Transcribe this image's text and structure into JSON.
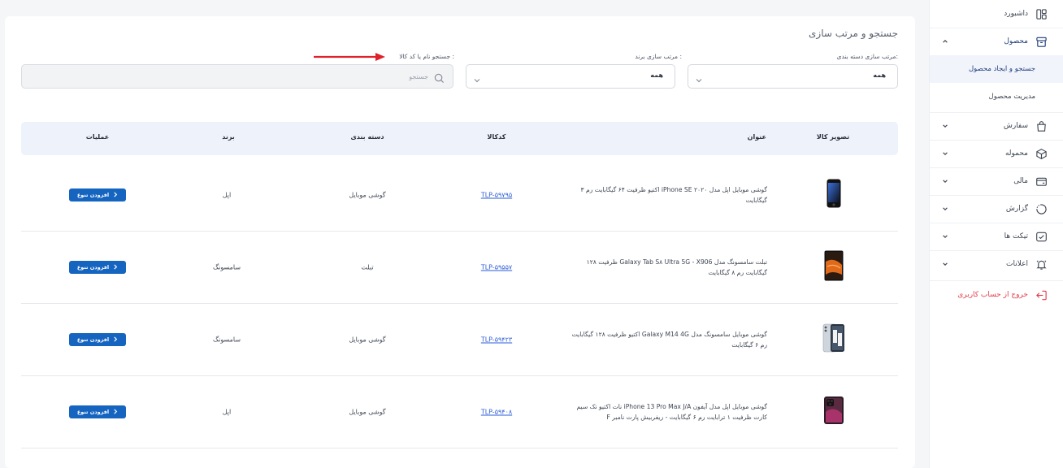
{
  "sidebar": {
    "items": [
      {
        "label": "داشبورد",
        "icon": "dashboard-icon"
      },
      {
        "label": "محصول",
        "icon": "box-icon"
      },
      {
        "label": "سفارش",
        "icon": "shopping-bag-icon"
      },
      {
        "label": "محموله",
        "icon": "package-icon"
      },
      {
        "label": "مالی",
        "icon": "wallet-icon"
      },
      {
        "label": "گزارش",
        "icon": "report-icon"
      },
      {
        "label": "تیکت ها",
        "icon": "ticket-icon"
      },
      {
        "label": "اعلانات",
        "icon": "bell-icon"
      }
    ],
    "sub_items": [
      {
        "label": "جستجو و ایجاد محصول"
      },
      {
        "label": "مدیریت محصول"
      }
    ],
    "logout_label": "خروج از حساب کاربری",
    "accent": "#1d3a7a",
    "logout_color": "#e23b4a"
  },
  "main": {
    "title": "جستجو و مرتب سازی",
    "filters": {
      "category_label": "مرتب سازی دسته بندی:",
      "category_value": "همه",
      "brand_label": "مرتب سازی برند :",
      "brand_value": "همه",
      "search_label": "جستجو نام یا کد کالا :",
      "search_placeholder": "جستجو"
    },
    "table": {
      "headers": {
        "image": "تصویر کالا",
        "title": "عنوان",
        "code": "کدکالا",
        "category": "دسته بندی",
        "brand": "برند",
        "actions": "عملیات"
      },
      "button_label": "افزودن تنوع",
      "rows": [
        {
          "title": "گوشی موبایل اپل مدل iPhone SE ۲۰۲۰ اکتیو ظرفیت ۶۴ گیگابایت رم ۳ گیگابایت",
          "code": "TLP-۵۹۷۹۵",
          "category": "گوشی موبایل",
          "brand": "اپل",
          "image": "iphone-se-image"
        },
        {
          "title": "تبلت سامسونگ مدل Galaxy Tab S۸ Ultra 5G - X906 ظرفیت ۱۲۸ گیگابایت رم ۸ گیگابایت",
          "code": "TLP-۵۹۵۵۷",
          "category": "تبلت",
          "brand": "سامسونگ",
          "image": "galaxy-tab-image"
        },
        {
          "title": "گوشی موبایل سامسونگ مدل Galaxy M14 4G اکتیو ظرفیت ۱۲۸ گیگابایت رم ۶ گیگابایت",
          "code": "TLP-۵۹۴۲۳",
          "category": "گوشی موبایل",
          "brand": "سامسونگ",
          "image": "galaxy-m14-image"
        },
        {
          "title": "گوشی موبایل اپل مدل آیفون iPhone 13 Pro Max J/A نات اکتیو تک سیم کارت ظرفیت ۱ ترابایت رم ۶ گیگابایت - ریفربیش پارت نامبر F",
          "code": "TLP-۵۹۴۰۸",
          "category": "گوشی موبایل",
          "brand": "اپل",
          "image": "iphone-13-pro-max-image"
        }
      ]
    },
    "button_color": "#1565c0",
    "link_color": "#2a5bd7",
    "arrow_color": "#e0202a"
  }
}
